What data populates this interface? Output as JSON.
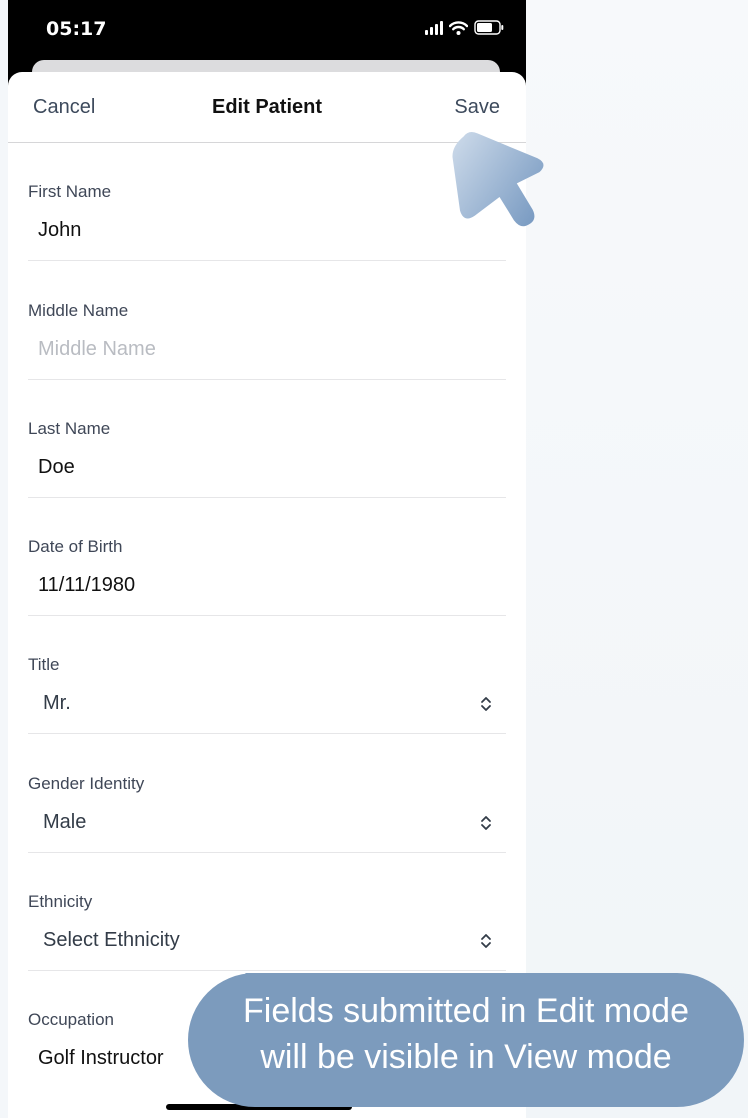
{
  "status_bar": {
    "time": "05:17"
  },
  "nav": {
    "cancel_label": "Cancel",
    "title": "Edit Patient",
    "save_label": "Save"
  },
  "fields": [
    {
      "label": "First Name",
      "value": "John",
      "kind": "text"
    },
    {
      "label": "Middle Name",
      "placeholder": "Middle Name",
      "kind": "text"
    },
    {
      "label": "Last Name",
      "value": "Doe",
      "kind": "text"
    },
    {
      "label": "Date of Birth",
      "value": "11/11/1980",
      "kind": "text"
    },
    {
      "label": "Title",
      "value": "Mr.",
      "kind": "select"
    },
    {
      "label": "Gender Identity",
      "value": "Male",
      "kind": "select"
    },
    {
      "label": "Ethnicity",
      "value": "Select Ethnicity",
      "kind": "select"
    },
    {
      "label": "Occupation",
      "value": "Golf Instructor",
      "kind": "text"
    }
  ],
  "callout": {
    "line1": "Fields submitted in Edit mode",
    "line2": "will be visible in View mode"
  },
  "colors": {
    "accent_text": "#3d4a5c",
    "callout_fill": "#7c9bbd",
    "arrow_fill": "#8fb0cf"
  },
  "icons": [
    "signal-icon",
    "wifi-icon",
    "battery-icon",
    "chevron-up-down-icon",
    "pointer-arrow-icon"
  ]
}
